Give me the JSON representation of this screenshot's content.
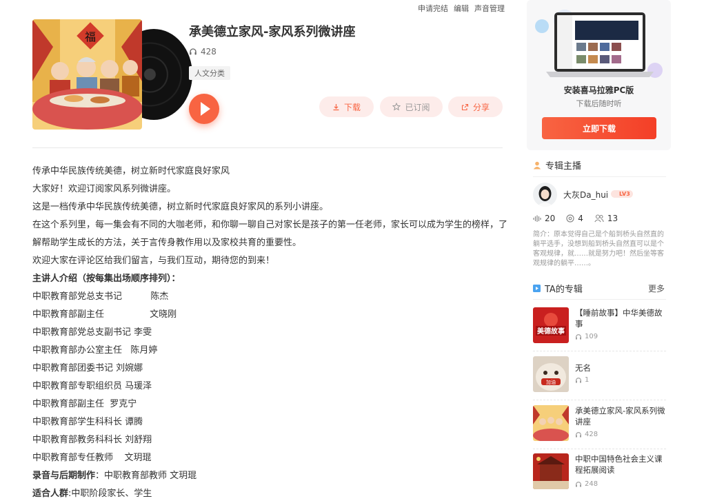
{
  "top_links": [
    "申请完结",
    "编辑",
    "声音管理"
  ],
  "album": {
    "title": "承美德立家风-家风系列微讲座",
    "play_count": "428",
    "category": "人文分类"
  },
  "actions": {
    "download": "下载",
    "subscribed": "已订阅",
    "share": "分享"
  },
  "intro": {
    "lines": [
      "传承中华民族传统美德，树立新时代家庭良好家风",
      "大家好！欢迎订阅家风系列微讲座。",
      "这是一档传承中华民族传统美德，树立新时代家庭良好家风的系列小讲座。",
      "在这个系列里，每一集会有不同的大咖老师，和你聊一聊自己对家长是孩子的第一任老师，家长可以成为学生的榜样，了解帮助学生成长的方法，关于言传身教作用以及家校共育的重要性。",
      "欢迎大家在评论区给我们留言，与我们互动，期待您的到来！"
    ],
    "speakers_heading": "主讲人介绍（按每集出场顺序排列）：",
    "speakers": [
      "中职教育部党总支书记          陈杰",
      "中职教育部副主任                文晓刚",
      "中职教育部党总支副书记 李雯",
      "中职教育部办公室主任   陈月婷",
      "中职教育部团委书记 刘婉娜",
      "中职教育部专职组织员 马瑗泽",
      "中职教育部副主任  罗克宁",
      "中职教育部学生科科长 谭腾",
      "中职教育部教务科科长 刘舒翔",
      "中职教育部专任教师    文玥琨"
    ],
    "production_label": "录音与后期制作",
    "production_value": "：中职教育部教师  文玥琨",
    "audience_label": "适合人群",
    "audience_value": ":中职阶段家长、学生"
  },
  "pc_promo": {
    "name": "安装喜马拉雅PC版",
    "sub": "下载后随时听",
    "button": "立即下载"
  },
  "anchor_section": {
    "title": "专辑主播",
    "name": "大灰Da_hui",
    "level": "LV3",
    "stats": {
      "tracks": "20",
      "albums": "4",
      "followers": "13"
    },
    "bio": "简介：原本觉得自己是个船到桥头自然直的躺平选手，没想到船到桥头自然直可以是个客观规律，就……就是努力吧！然后坐等客观规律的躺平……。"
  },
  "ta_albums": {
    "title": "TA的专辑",
    "more": "更多",
    "items": [
      {
        "name": "【睡前故事】中华美德故事",
        "plays": "109",
        "thumb_text": "美德故事"
      },
      {
        "name": "无名",
        "plays": "1",
        "thumb_text": "加油"
      },
      {
        "name": "承美德立家风-家风系列微讲座",
        "plays": "428"
      },
      {
        "name": "中职中国特色社会主义课程拓展阅读",
        "plays": "248"
      }
    ]
  },
  "colors": {
    "accent": "#f86442",
    "accent_light": "#fdecea"
  }
}
